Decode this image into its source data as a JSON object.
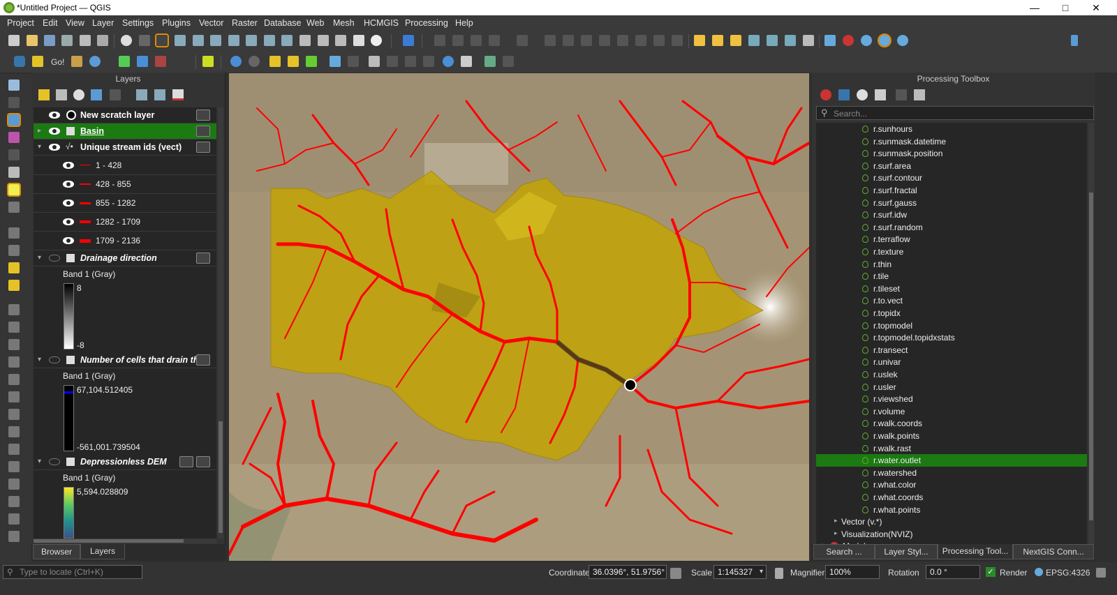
{
  "window": {
    "title": "*Untitled Project — QGIS"
  },
  "menu": [
    "Project",
    "Edit",
    "View",
    "Layer",
    "Settings",
    "Plugins",
    "Vector",
    "Raster",
    "Database",
    "Web",
    "Mesh",
    "HCMGIS",
    "Processing",
    "Help"
  ],
  "toolbar2": {
    "go_label": "Go!"
  },
  "layers_panel": {
    "title": "Layers",
    "items": [
      {
        "label": "New scratch layer"
      },
      {
        "label": "Basin"
      },
      {
        "label": "Unique stream ids (vect)"
      },
      {
        "label": "1 - 428"
      },
      {
        "label": "428 - 855"
      },
      {
        "label": "855 - 1282"
      },
      {
        "label": "1282 - 1709"
      },
      {
        "label": "1709 - 2136"
      },
      {
        "label": "Drainage direction"
      },
      {
        "label": "Number of cells that drain thr"
      },
      {
        "label": "Depressionless DEM"
      }
    ],
    "drainage_legend": {
      "band": "Band 1 (Gray)",
      "max": "8",
      "min": "-8"
    },
    "cells_legend": {
      "band": "Band 1 (Gray)",
      "max": "67,104.512405",
      "min": "-561,001.739504"
    },
    "dem_legend": {
      "band": "Band 1 (Gray)",
      "max": "5,594.028809"
    },
    "tabs": [
      "Browser",
      "Layers"
    ]
  },
  "toolbox": {
    "title": "Processing Toolbox",
    "search_placeholder": "Search...",
    "algorithms": [
      "r.sunhours",
      "r.sunmask.datetime",
      "r.sunmask.position",
      "r.surf.area",
      "r.surf.contour",
      "r.surf.fractal",
      "r.surf.gauss",
      "r.surf.idw",
      "r.surf.random",
      "r.terraflow",
      "r.texture",
      "r.thin",
      "r.tile",
      "r.tileset",
      "r.to.vect",
      "r.topidx",
      "r.topmodel",
      "r.topmodel.topidxstats",
      "r.transect",
      "r.univar",
      "r.uslek",
      "r.usler",
      "r.viewshed",
      "r.volume",
      "r.walk.coords",
      "r.walk.points",
      "r.walk.rast",
      "r.water.outlet",
      "r.watershed",
      "r.what.color",
      "r.what.coords",
      "r.what.points"
    ],
    "selected": "r.water.outlet",
    "groups": [
      "Vector (v.*)",
      "Visualization(NVIZ)",
      "Models"
    ],
    "tabs": [
      "Search ...",
      "Layer Styl...",
      "Processing Tool...",
      "NextGIS Conn..."
    ]
  },
  "status": {
    "locate_placeholder": "Type to locate (Ctrl+K)",
    "coordinate_label": "Coordinate",
    "coordinate_value": "36.0396°, 51.9756°",
    "scale_label": "Scale",
    "scale_value": "1:145327",
    "magnifier_label": "Magnifier",
    "magnifier_value": "100%",
    "rotation_label": "Rotation",
    "rotation_value": "0.0 °",
    "render_label": "Render",
    "crs": "EPSG:4326"
  },
  "colors": {
    "selection": "#1b7a12",
    "stream": "#ff0000",
    "basin": "#c9a800"
  }
}
